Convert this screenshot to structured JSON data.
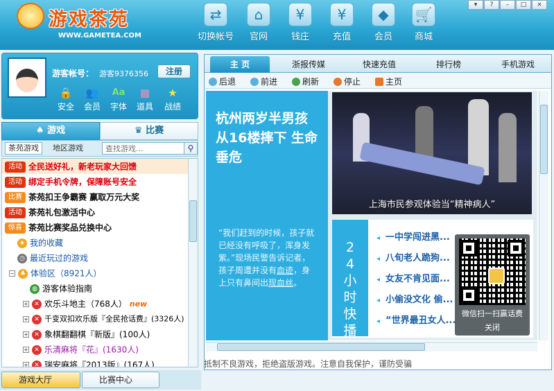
{
  "logo": {
    "brand": "游戏茶苑",
    "site": "WWW.GAMETEA.COM"
  },
  "topnav": [
    {
      "label": "切换帐号",
      "icon": "switch-account-icon",
      "glyph": "⇄"
    },
    {
      "label": "官网",
      "icon": "home-icon",
      "glyph": "⌂"
    },
    {
      "label": "钱庄",
      "icon": "bank-icon",
      "glyph": "¥"
    },
    {
      "label": "充值",
      "icon": "recharge-icon",
      "glyph": "¥"
    },
    {
      "label": "会员",
      "icon": "diamond-icon",
      "glyph": "◆"
    },
    {
      "label": "商城",
      "icon": "cart-icon",
      "glyph": "🛒"
    }
  ],
  "window_controls": [
    "▾",
    "?",
    "–",
    "□",
    "×"
  ],
  "user": {
    "label": "游客帐号：",
    "value": "游客9376356",
    "register": "注册",
    "actions": [
      {
        "label": "安全",
        "glyph": "🔒",
        "color": "#f4c542"
      },
      {
        "label": "会员",
        "glyph": "👥",
        "color": "#ffffff"
      },
      {
        "label": "字体",
        "glyph": "Aa",
        "color": "#7be37b"
      },
      {
        "label": "道具",
        "glyph": "▦",
        "color": "#f28fb8"
      },
      {
        "label": "战绩",
        "glyph": "★",
        "color": "#ffe14d"
      }
    ]
  },
  "left_tabs": {
    "game": "游戏",
    "match": "比赛"
  },
  "filter": {
    "tab1": "茶苑游戏",
    "tab2": "地区游戏",
    "search_placeholder": "查找游戏..."
  },
  "list": [
    {
      "tag": "活动",
      "text": "全民送好礼，新老玩家大回馈"
    },
    {
      "tag": "活动",
      "text": "绑定手机令牌，保障账号安全"
    },
    {
      "tag": "比赛",
      "text": "茶苑扣王争霸赛 赢取万元大奖"
    },
    {
      "tag": "活动",
      "text": "茶苑礼包激活中心"
    },
    {
      "tag": "惊喜",
      "text": "茶苑比赛奖品兑换中心"
    },
    {
      "text": "我的收藏"
    },
    {
      "text": "最近玩过的游戏"
    },
    {
      "text": "体验区（8921人）"
    },
    {
      "text": "游客体验指南"
    },
    {
      "text": "欢乐斗地主（768人）",
      "badge": "new"
    },
    {
      "text": "千变双扣欢乐版『全民抢话费』(3326人)"
    },
    {
      "text": "象棋翻翻棋『新版』(100人)"
    },
    {
      "text": "乐清麻将『花』(1630人)"
    },
    {
      "text": "瑞安麻将『2013版』(167人)"
    }
  ],
  "bottom_tabs": {
    "hall": "游戏大厅",
    "match": "比赛中心"
  },
  "right_tabs": [
    "主 页",
    "浙报传媒",
    "快速充值",
    "排行榜",
    "手机游戏"
  ],
  "navbar": {
    "back": "后退",
    "forward": "前进",
    "refresh": "刷新",
    "stop": "停止",
    "home": "主页"
  },
  "news": {
    "headline": "杭州两岁半男孩从16楼摔下 生命垂危",
    "photo_caption": "上海市民参观体验当“精神病人”",
    "quote_start": "“我们赶到的时候，孩子就已经没有呼吸了，浑身发紫。”现场民警告诉记者，孩子周遭并没有",
    "quote_link1": "血迹",
    "quote_mid": "，身上只有鼻间出",
    "quote_link2": "现血丝",
    "quote_end": "。",
    "quick_title": "24小时快播",
    "items": [
      "一中学闯进黑...",
      "八旬老人跪狗...",
      "女友不肯见面...",
      "小偷没文化 偷...",
      "“世界最丑女人..."
    ]
  },
  "status": "抵制不良游戏，拒绝盗版游戏。注意自我保护，谨防受骗上当。",
  "qr": {
    "text": "微信扫一扫赢话费",
    "close": "关闭"
  }
}
